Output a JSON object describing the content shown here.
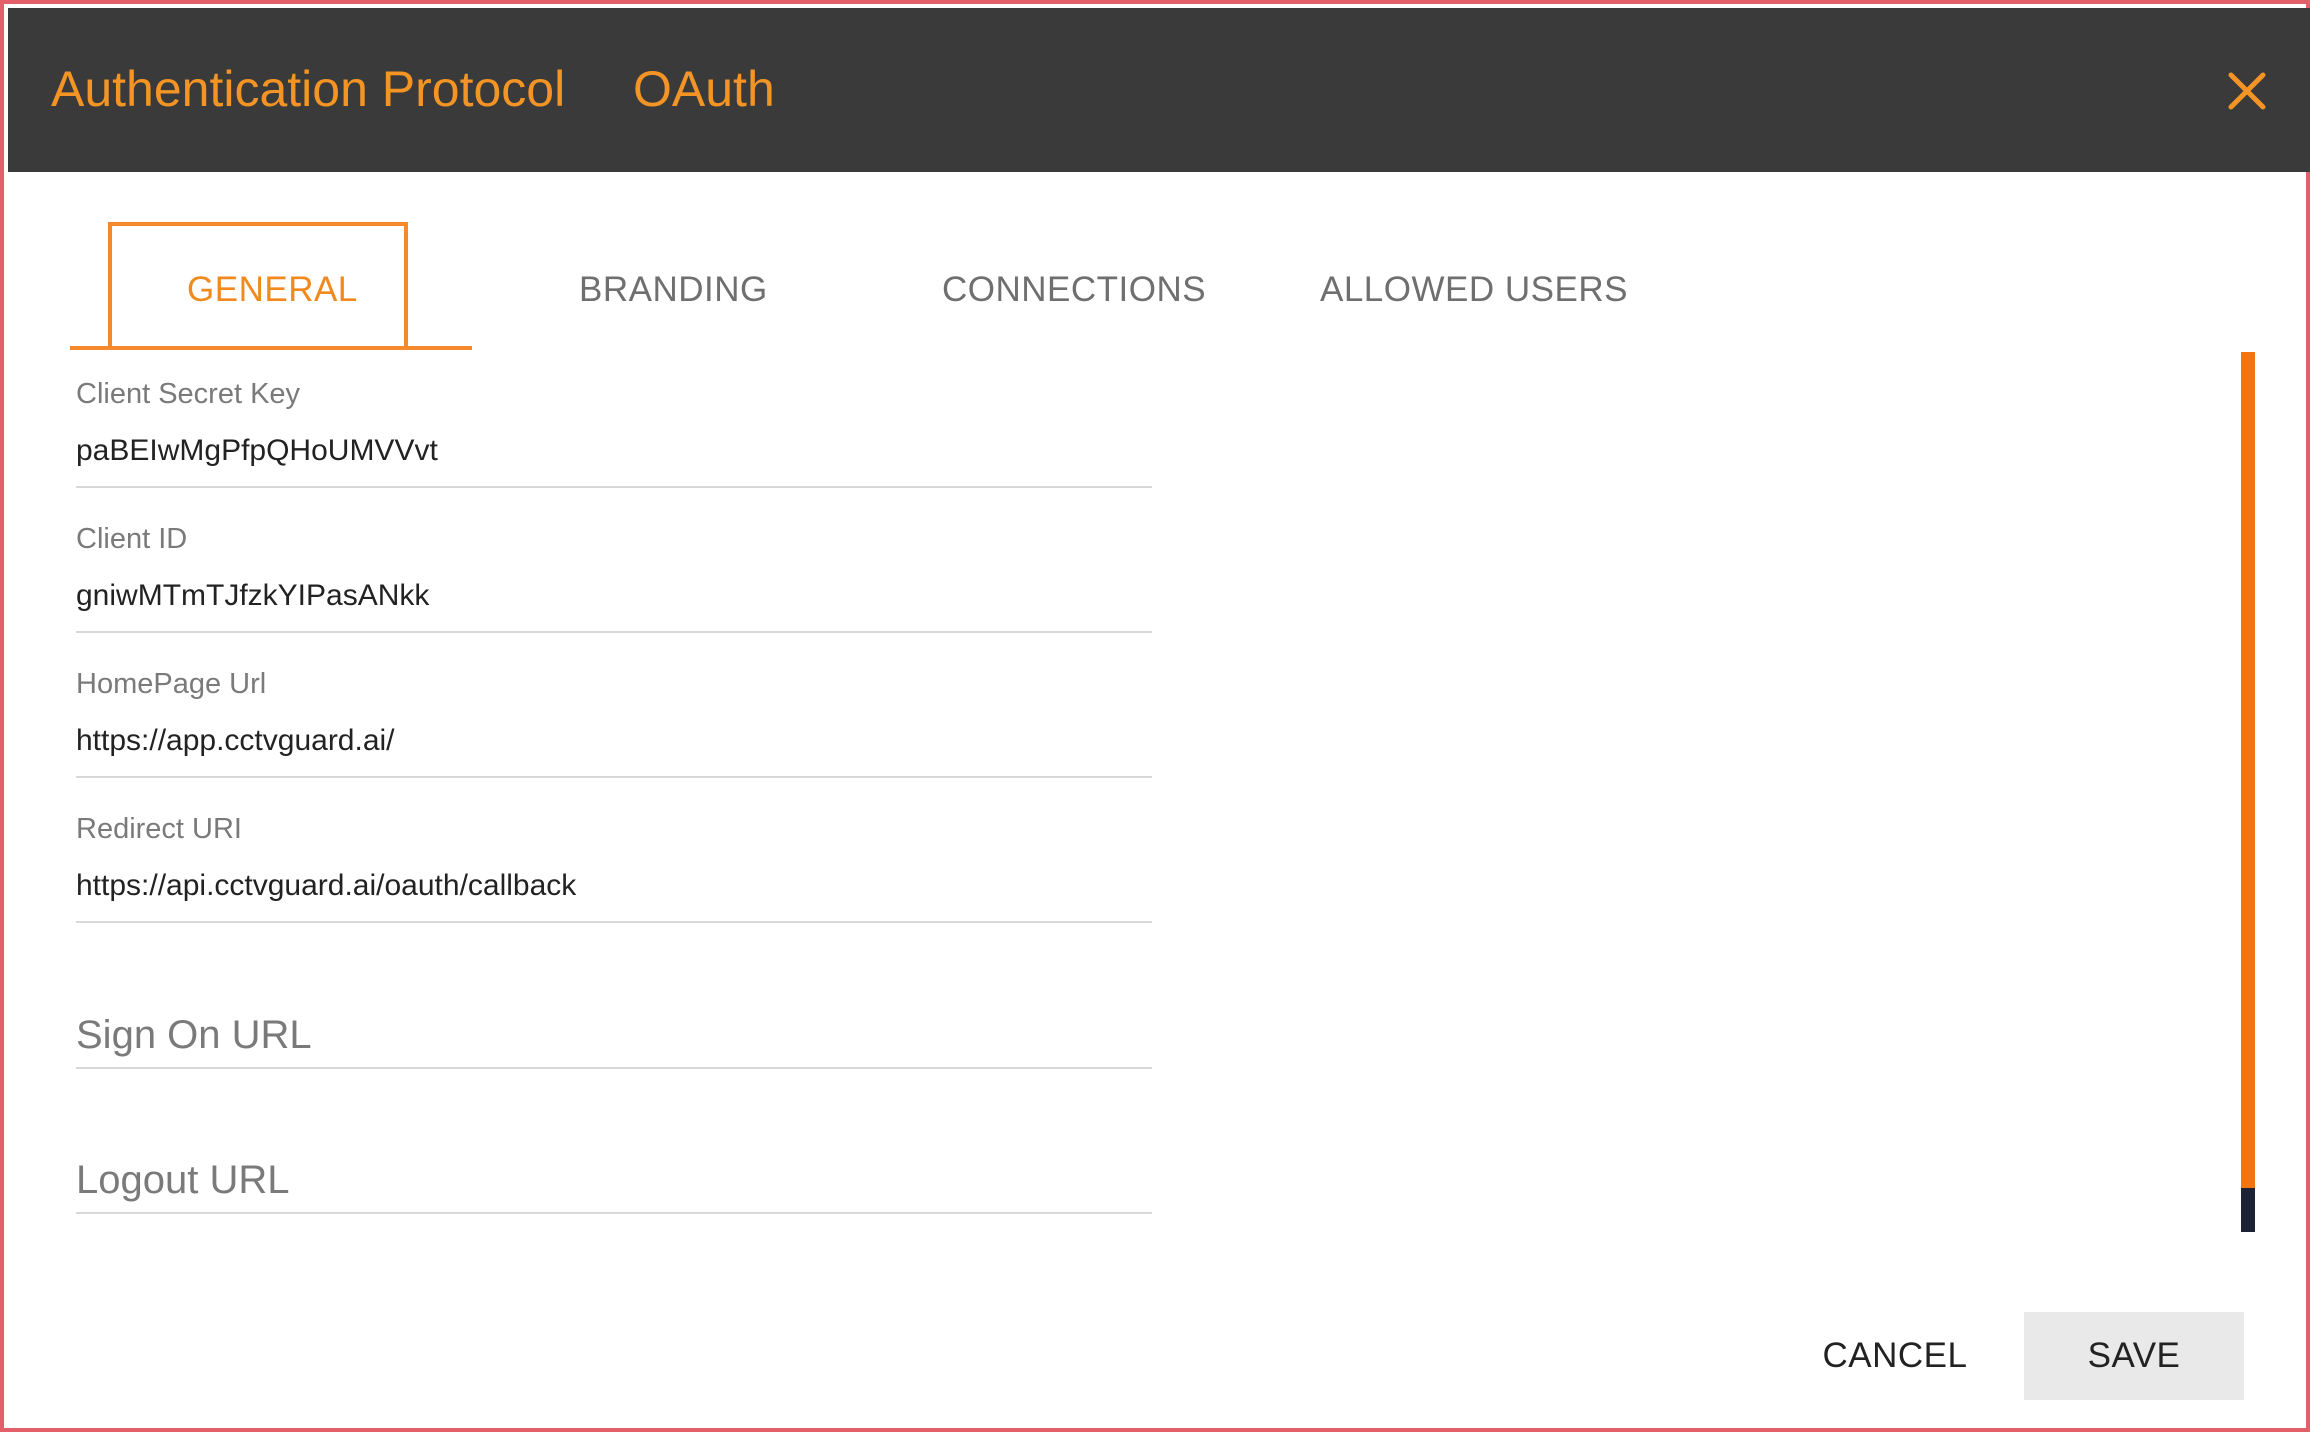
{
  "header": {
    "title": "Authentication Protocol",
    "protocol": "OAuth",
    "close_icon": "close-icon",
    "accent_color": "#f39425",
    "background_color": "#3a3a3a"
  },
  "tabs": [
    {
      "label": "GENERAL",
      "active": true
    },
    {
      "label": "BRANDING",
      "active": false
    },
    {
      "label": "CONNECTIONS",
      "active": false
    },
    {
      "label": "ALLOWED USERS",
      "active": false
    }
  ],
  "fields": {
    "client_secret": {
      "label": "Client Secret Key",
      "value": "paBEIwMgPfpQHoUMVVvt"
    },
    "client_id": {
      "label": "Client ID",
      "value": "gniwMTmTJfzkYIPasANkk"
    },
    "homepage_url": {
      "label": "HomePage Url",
      "value": "https://app.cctvguard.ai/"
    },
    "redirect_uri": {
      "label": "Redirect URI",
      "value": "https://api.cctvguard.ai/oauth/callback"
    },
    "sign_on_url": {
      "placeholder": "Sign On URL",
      "value": ""
    },
    "logout_url": {
      "placeholder": "Logout URL",
      "value": ""
    }
  },
  "scrollbar": {
    "color": "#f47410",
    "thumb_color": "#1c2233"
  },
  "footer": {
    "cancel_label": "CANCEL",
    "save_label": "SAVE"
  }
}
